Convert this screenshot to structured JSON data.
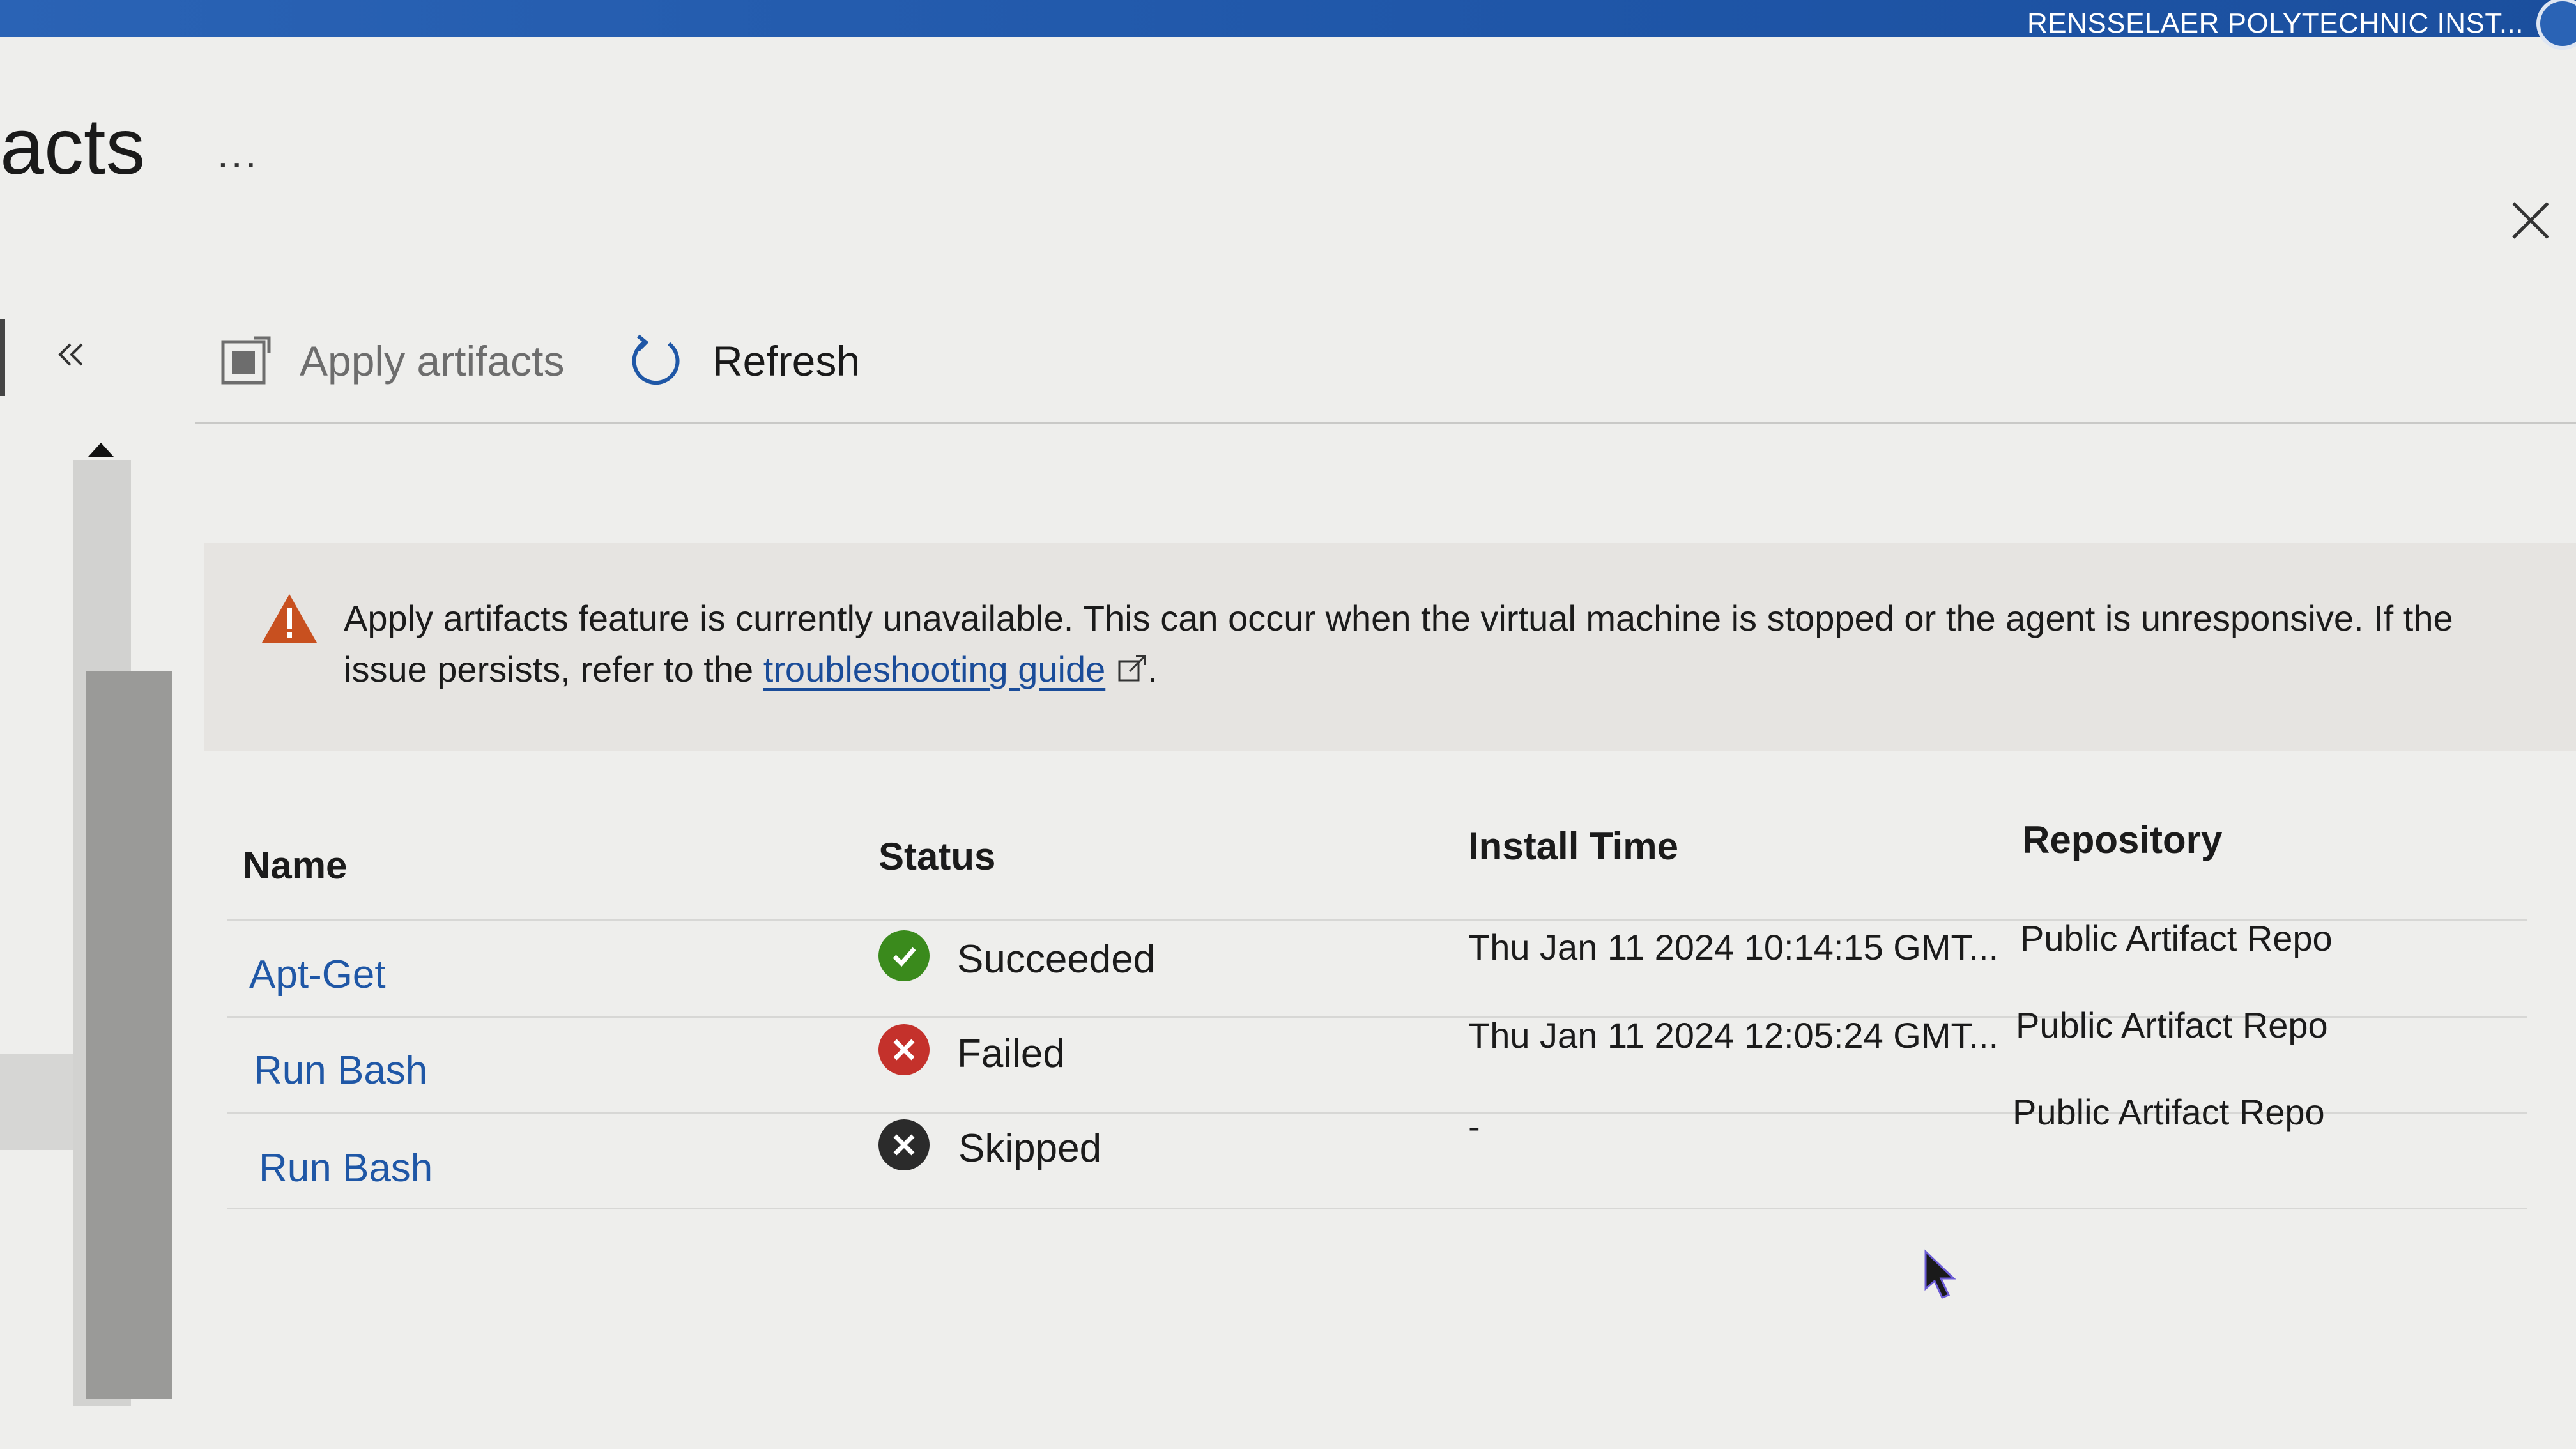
{
  "header": {
    "org_name": "RENSSELAER POLYTECHNIC INST...",
    "bar_color": "#2a63b5"
  },
  "page": {
    "title": "acts",
    "more_label": "..."
  },
  "toolbar": {
    "apply_label": "Apply artifacts",
    "refresh_label": "Refresh"
  },
  "banner": {
    "text_before_link": "Apply artifacts feature is currently unavailable. This can occur when the virtual machine is stopped or the agent is unresponsive. If the issue persists, refer to the ",
    "link_text": "troubleshooting guide",
    "text_after_link": ".",
    "icon": "warning-icon",
    "icon_color": "#c8501f"
  },
  "table": {
    "columns": [
      "Name",
      "Status",
      "Install Time",
      "Repository"
    ],
    "rows": [
      {
        "name": "Apt-Get",
        "status": "Succeeded",
        "status_icon": "success-icon",
        "install_time": "Thu Jan 11 2024 10:14:15 GMT...",
        "repository": "Public Artifact Repo"
      },
      {
        "name": "Run Bash",
        "status": "Failed",
        "status_icon": "error-icon",
        "install_time": "Thu Jan 11 2024 12:05:24 GMT...",
        "repository": "Public Artifact Repo"
      },
      {
        "name": "Run Bash",
        "status": "Skipped",
        "status_icon": "skipped-icon",
        "install_time": "-",
        "repository": "Public Artifact Repo"
      }
    ]
  },
  "colors": {
    "success": "#3a8a1c",
    "error": "#c4312b",
    "skipped": "#2b2b2b",
    "link": "#1f57a6"
  }
}
